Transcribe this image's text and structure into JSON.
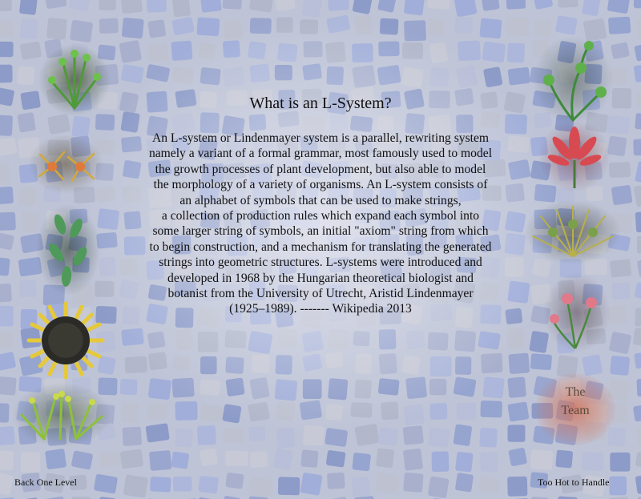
{
  "page": {
    "title": "What is an L-System?",
    "paragraph_lines": [
      "An L-system or Lindenmayer system is a parallel, rewriting system",
      "namely a variant of a formal grammar, most famously used to model",
      "the growth processes of plant development, but also able to model",
      "the morphology of a variety of organisms. An L-system consists of",
      "an alphabet of symbols that can be used to make strings,",
      "a collection of production rules which expand each symbol into",
      "some larger string of symbols, an initial \"axiom\" string from which",
      "to begin construction, and a mechanism for translating the generated",
      "strings into geometric structures. L-systems were introduced and",
      "developed in 1968 by the Hungarian theoretical biologist and",
      "botanist from the  University of Utrecht, Aristid Lindenmayer",
      "(1925–1989). ------- Wikipedia 2013"
    ]
  },
  "team_link": {
    "line1": "The",
    "line2": "Team"
  },
  "nav": {
    "back_label": "Back One Level",
    "next_label": "Too Hot to Handle"
  },
  "left_plants": [
    "green-shrub-image",
    "orange-flower-image",
    "leafy-plant-image",
    "sunflower-image",
    "yellow-green-shrub-image"
  ],
  "right_plants": [
    "fern-image",
    "red-flower-image",
    "grass-shrub-image",
    "pink-flower-image"
  ],
  "colors": {
    "tile_blue": "#8a9acb",
    "tile_gray": "#aab0c4",
    "accent_team": "#d66e50"
  }
}
